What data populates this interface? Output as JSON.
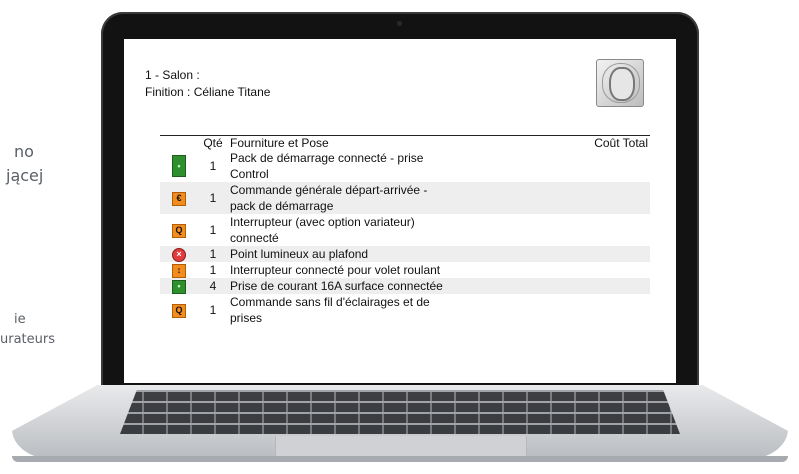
{
  "background_text": {
    "line1": "no",
    "line2": "jącej",
    "line3": "ie",
    "line4": "urateurs"
  },
  "quote": {
    "room_title": "1 - Salon :",
    "finish_label": "Finition :",
    "finish_value": "Céliane Titane",
    "headers": {
      "qty": "Qté",
      "description": "Fourniture et Pose",
      "total": "Coût Total"
    },
    "rows": [
      {
        "icon": "connected-socket-pack-icon",
        "qty": "1",
        "line1": "Pack de démarrage connecté - prise",
        "line2": "Control",
        "shaded": false
      },
      {
        "icon": "general-command-icon",
        "qty": "1",
        "line1": "Commande générale départ-arrivée -",
        "line2": "pack de démarrage",
        "shaded": true
      },
      {
        "icon": "dimmer-switch-icon",
        "qty": "1",
        "line1": "Interrupteur (avec option variateur)",
        "line2": "connecté",
        "shaded": false
      },
      {
        "icon": "ceiling-light-point-icon",
        "qty": "1",
        "line1": "Point lumineux au plafond",
        "line2": "",
        "shaded": true
      },
      {
        "icon": "shutter-switch-icon",
        "qty": "1",
        "line1": "Interrupteur connecté pour volet roulant",
        "line2": "",
        "shaded": false
      },
      {
        "icon": "connected-socket-icon",
        "qty": "4",
        "line1": "Prise de courant 16A surface connectée",
        "line2": "",
        "shaded": true
      },
      {
        "icon": "wireless-command-icon",
        "qty": "1",
        "line1": "Commande sans fil d'éclairages et de",
        "line2": "prises",
        "shaded": false
      }
    ]
  },
  "colors": {
    "icon_green": "#2f8f2f",
    "icon_orange": "#f28c1c",
    "icon_red": "#e23b3b",
    "row_shade": "#eeeeee"
  }
}
